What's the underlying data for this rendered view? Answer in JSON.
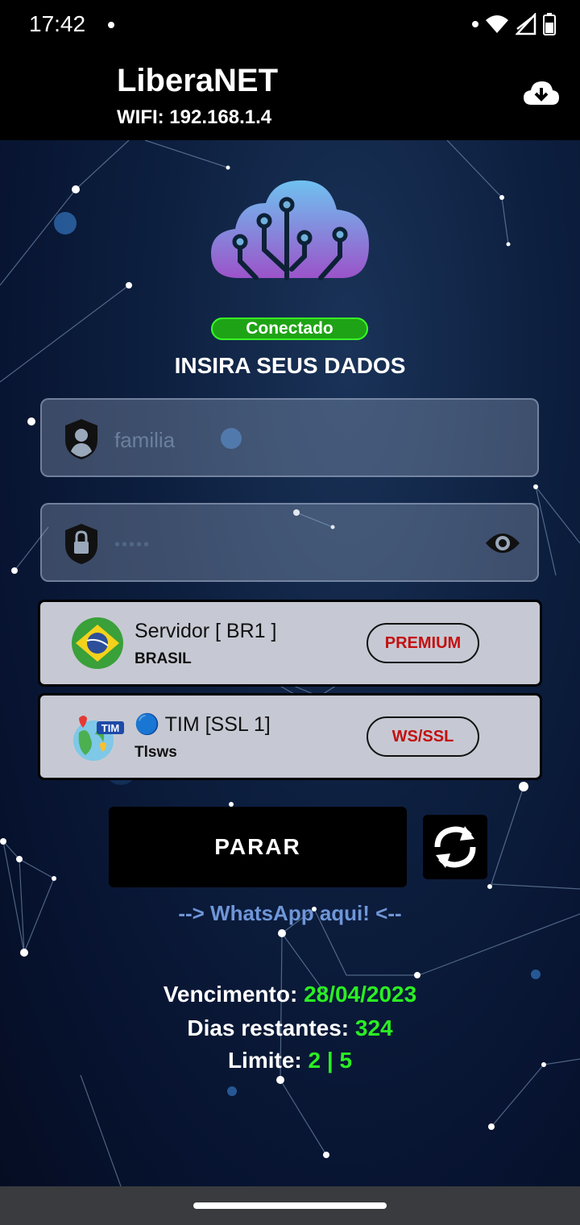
{
  "status_bar": {
    "time": "17:42"
  },
  "app": {
    "title": "LiberaNET",
    "subtitle": "WIFI: 192.168.1.4"
  },
  "connection_badge": "Conectado",
  "heading": "INSIRA SEUS DADOS",
  "username_field": {
    "placeholder": "familia"
  },
  "password_field": {
    "value": "•••••"
  },
  "server_card": {
    "name": "Servidor [ BR1 ]",
    "country": "BRASIL",
    "tag": "PREMIUM"
  },
  "network_card": {
    "name": "🔵 TIM [SSL 1]",
    "mode": "Tlsws",
    "tag": "WS/SSL",
    "icon_label": "TIM"
  },
  "stop_button": "PARAR",
  "whatsapp_link": "--> WhatsApp aqui! <--",
  "info": {
    "expiry_label": "Vencimento:",
    "expiry_value": "28/04/2023",
    "days_label": "Dias restantes:",
    "days_value": "324",
    "limit_label": "Limite:",
    "limit_value": "2 | 5"
  },
  "colors": {
    "accent_green": "#2af022",
    "tag_red": "#c31010",
    "link_blue": "#6f96d8"
  }
}
